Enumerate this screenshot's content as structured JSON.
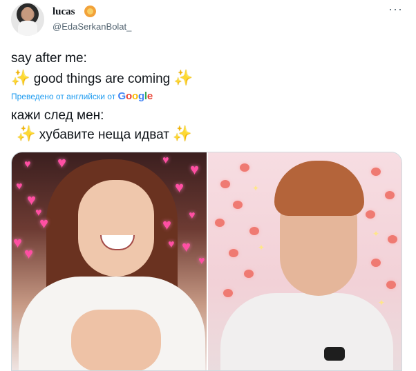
{
  "tweet": {
    "display_name": "lucas",
    "handle": "@EdaSerkanBolat_",
    "more_icon": "ellipsis-icon",
    "text_line_1": "say after me:",
    "text_line_2": "good things are coming",
    "translated_label": "Преведено от английски от",
    "translator": "Google",
    "translated_line_1": "кажи след мен:",
    "translated_line_2": "хубавите неща идват",
    "sparkle_icon": "✨",
    "colors": {
      "link": "#1d9bf0",
      "secondary_text": "#536471",
      "heart": "#ff4fa3"
    }
  }
}
